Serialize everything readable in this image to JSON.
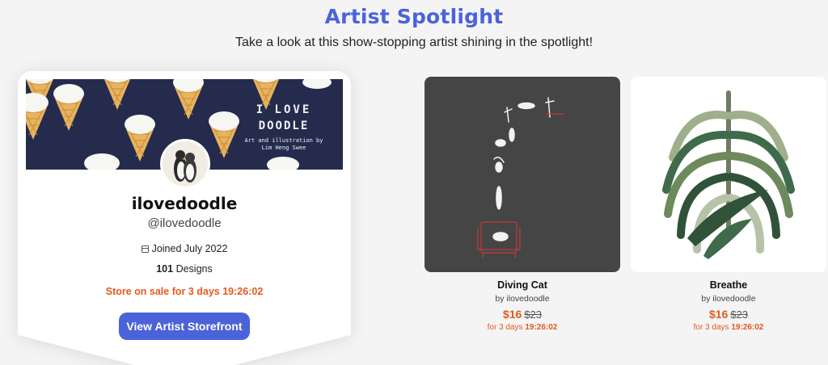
{
  "header": {
    "title": "Artist Spotlight",
    "subtitle": "Take a look at this show-stopping artist shining in the spotlight!"
  },
  "artist_card": {
    "banner": {
      "line1": "I LOVE",
      "line2": "DOODLE",
      "line3": "Art and illustration by Lim Heng Swee"
    },
    "name": "ilovedoodle",
    "handle": "@ilovedoodle",
    "joined": "Joined July 2022",
    "designs_count": "101",
    "designs_label": "Designs",
    "sale_text": "Store on sale for 3 days 19:26:02",
    "button_label": "View Artist Storefront"
  },
  "products": [
    {
      "name": "Diving Cat",
      "by": "by ilovedoodle",
      "price": "$16",
      "old_price": "$23",
      "days_prefix": "for 3 days",
      "timer": "19:26:02"
    },
    {
      "name": "Breathe",
      "by": "by ilovedoodle",
      "price": "$16",
      "old_price": "$23",
      "days_prefix": "for 3 days",
      "timer": "19:26:02"
    }
  ],
  "colors": {
    "accent": "#4b63d8",
    "sale": "#e35a1f",
    "banner_bg": "#252b4d"
  }
}
